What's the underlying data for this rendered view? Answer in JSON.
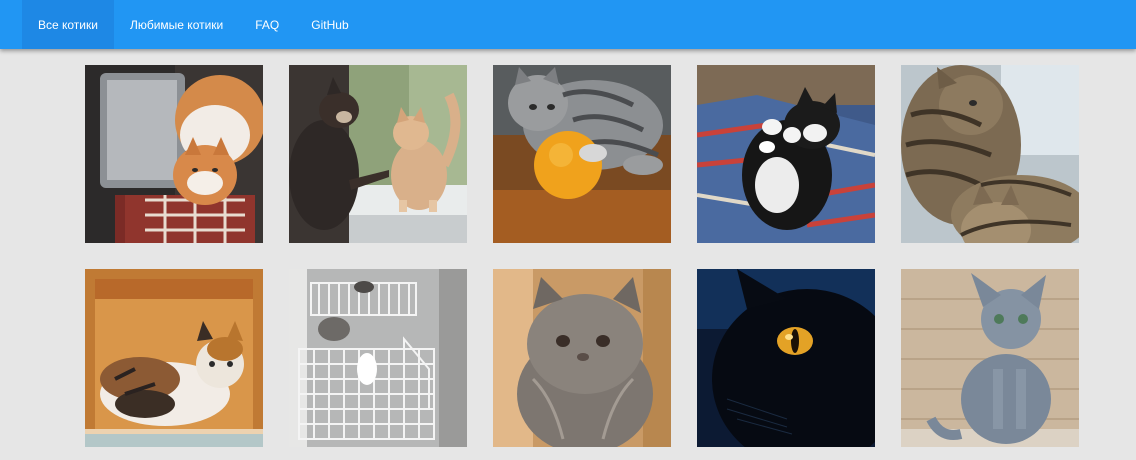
{
  "nav": {
    "items": [
      {
        "label": "Все котики",
        "active": true
      },
      {
        "label": "Любимые котики",
        "active": false
      },
      {
        "label": "FAQ",
        "active": false
      },
      {
        "label": "GitHub",
        "active": false
      }
    ]
  },
  "colors": {
    "topbar": "#2196f3",
    "topbar_active": "#1e88e5",
    "page_background": "#e6e6e6"
  },
  "gallery": {
    "photos": [
      {
        "subject": "ginger-white cat on open suitcase"
      },
      {
        "subject": "dark cat and ginger kitten at window"
      },
      {
        "subject": "tabby kitten with orange fruit"
      },
      {
        "subject": "black-white kitten lying on blanket"
      },
      {
        "subject": "two tabby cats cuddling"
      },
      {
        "subject": "calico cat in wooden cabinet"
      },
      {
        "subject": "kitten in dishwasher rack"
      },
      {
        "subject": "fluffy grey persian kitten"
      },
      {
        "subject": "black cat with yellow eye"
      },
      {
        "subject": "grey russian blue cat sitting"
      }
    ]
  }
}
